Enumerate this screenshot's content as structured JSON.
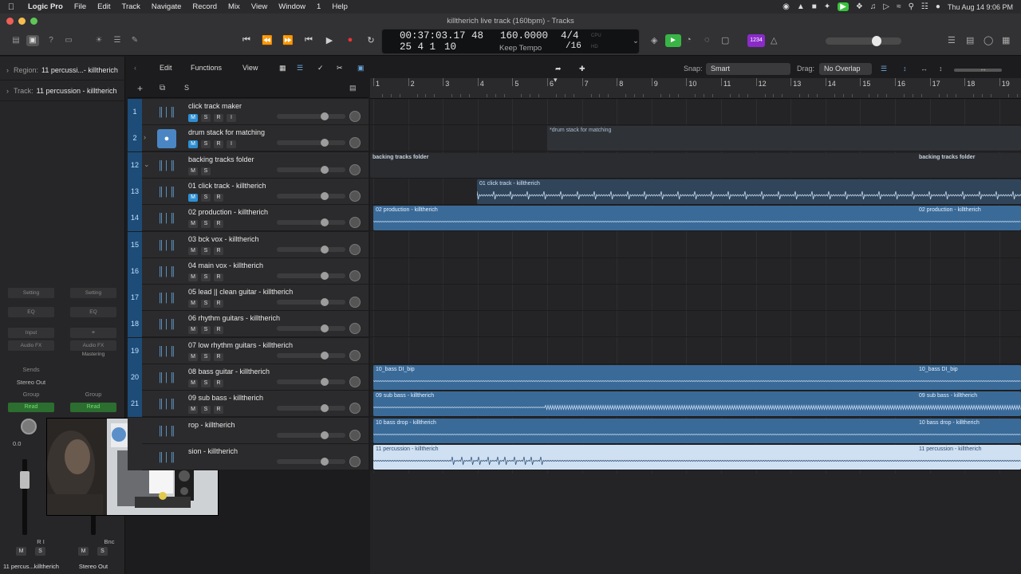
{
  "menubar": {
    "apple_icon": "apple-icon",
    "items": [
      "Logic Pro",
      "File",
      "Edit",
      "Track",
      "Navigate",
      "Record",
      "Mix",
      "View",
      "Window",
      "1",
      "Help"
    ],
    "clock": "Thu Aug 14  9:06 PM"
  },
  "window": {
    "title": "killtherich live track (160bpm) - Tracks"
  },
  "lcd": {
    "time": "00:37:03.17",
    "bars": "25  4  1",
    "ticks": "10",
    "bar_count": "48",
    "tempo": "160.0000",
    "tempo_mode": "Keep Tempo",
    "sig": "4/4",
    "division": "/16",
    "dim_cpu": "CPU",
    "dim_hd": "HD"
  },
  "controlbar": {
    "purple_badge": "1234"
  },
  "inspector": {
    "region_label": "Region:",
    "region_value": "11 percussi...- killtherich",
    "track_label": "Track:",
    "track_value": "11 percussion - killtherich",
    "strips": [
      {
        "setting": "Setting",
        "eq": "EQ",
        "input": "Input",
        "audio_fx": "Audio FX",
        "sends": "Sends",
        "output": "Stereo Out",
        "group": "Group",
        "automation": "Read",
        "value": "0.0",
        "name": "11 percus...killtherich",
        "ri": "R  I"
      },
      {
        "setting": "Setting",
        "eq": "EQ",
        "input": "",
        "audio_fx": "Audio FX",
        "mastering": "Mastering",
        "group": "Group",
        "automation": "Read",
        "bnc": "Bnc",
        "name": "Stereo Out"
      }
    ]
  },
  "tracks_toolbar": {
    "edit": "Edit",
    "functions": "Functions",
    "view": "View",
    "add": "+",
    "s": "S"
  },
  "arrange_toolbar": {
    "snap_label": "Snap:",
    "snap_value": "Smart",
    "drag_label": "Drag:",
    "drag_value": "No Overlap"
  },
  "ruler": {
    "bars": [
      "1",
      "2",
      "3",
      "4",
      "5",
      "6",
      "7",
      "8",
      "9",
      "10",
      "11",
      "12",
      "13",
      "14",
      "15",
      "16",
      "17",
      "18",
      "19"
    ]
  },
  "tracks": [
    {
      "num": "1",
      "name": "click track maker",
      "buttons": [
        "M",
        "S",
        "R",
        "I"
      ],
      "icon": "waveform-icon"
    },
    {
      "num": "2",
      "name": "drum stack for matching",
      "buttons": [
        "M",
        "S",
        "R",
        "I"
      ],
      "icon": "drummer-icon",
      "disclose": "›"
    },
    {
      "num": "12",
      "name": "backing tracks folder",
      "buttons": [
        "M",
        "S"
      ],
      "icon": "waveform-icon",
      "disclose": "⌄"
    },
    {
      "num": "13",
      "name": "01 click track - killtherich",
      "buttons": [
        "M",
        "S",
        "R"
      ],
      "icon": "waveform-icon"
    },
    {
      "num": "14",
      "name": "02 production - killtherich",
      "buttons": [
        "M",
        "S",
        "R"
      ],
      "icon": "waveform-icon"
    },
    {
      "num": "15",
      "name": "03 bck vox - killtherich",
      "buttons": [
        "M",
        "S",
        "R"
      ],
      "icon": "waveform-icon"
    },
    {
      "num": "16",
      "name": "04 main vox - killtherich",
      "buttons": [
        "M",
        "S",
        "R"
      ],
      "icon": "waveform-icon"
    },
    {
      "num": "17",
      "name": "05 lead || clean guitar - killtherich",
      "buttons": [
        "M",
        "S",
        "R"
      ],
      "icon": "waveform-icon"
    },
    {
      "num": "18",
      "name": "06 rhythm guitars - killtherich",
      "buttons": [
        "M",
        "S",
        "R"
      ],
      "icon": "waveform-icon"
    },
    {
      "num": "19",
      "name": "07 low rhythm guitars - killtherich",
      "buttons": [
        "M",
        "S",
        "R"
      ],
      "icon": "waveform-icon"
    },
    {
      "num": "20",
      "name": "08 bass guitar - killtherich",
      "buttons": [
        "M",
        "S",
        "R"
      ],
      "icon": "waveform-icon"
    },
    {
      "num": "21",
      "name": "09 sub bass - killtherich",
      "buttons": [
        "M",
        "S",
        "R"
      ],
      "icon": "waveform-icon"
    },
    {
      "num": "",
      "name": "rop - killtherich",
      "buttons": [],
      "icon": "waveform-icon"
    },
    {
      "num": "",
      "name": "sion - killtherich",
      "buttons": [],
      "icon": "waveform-icon"
    }
  ],
  "regions": {
    "drum_stack": "*drum stack for matching",
    "folder_start": "backing tracks folder",
    "folder_end": "backing tracks folder",
    "click": "01 click track - killtherich",
    "production_start": "02 production - killtherich",
    "production_end": "02 production - killtherich",
    "bass_start": "10_bass DI_bip",
    "bass_end": "10_bass DI_bip",
    "sub_start": "09 sub bass - killtherich",
    "sub_end": "09 sub bass - killtherich",
    "drop_start": "10 bass drop - killtherich",
    "drop_end": "10 bass drop - killtherich",
    "perc_start": "11 percussion - killtherich",
    "perc_end": "11 percussion - killtherich"
  },
  "colors": {
    "track_number_bg": "#1d4c78",
    "region_blue": "#3a6a98",
    "region_selected": "#cfe0f2",
    "record_red": "#e33333",
    "accent_green": "#37c23b",
    "accent_purple": "#8a2bc9"
  }
}
